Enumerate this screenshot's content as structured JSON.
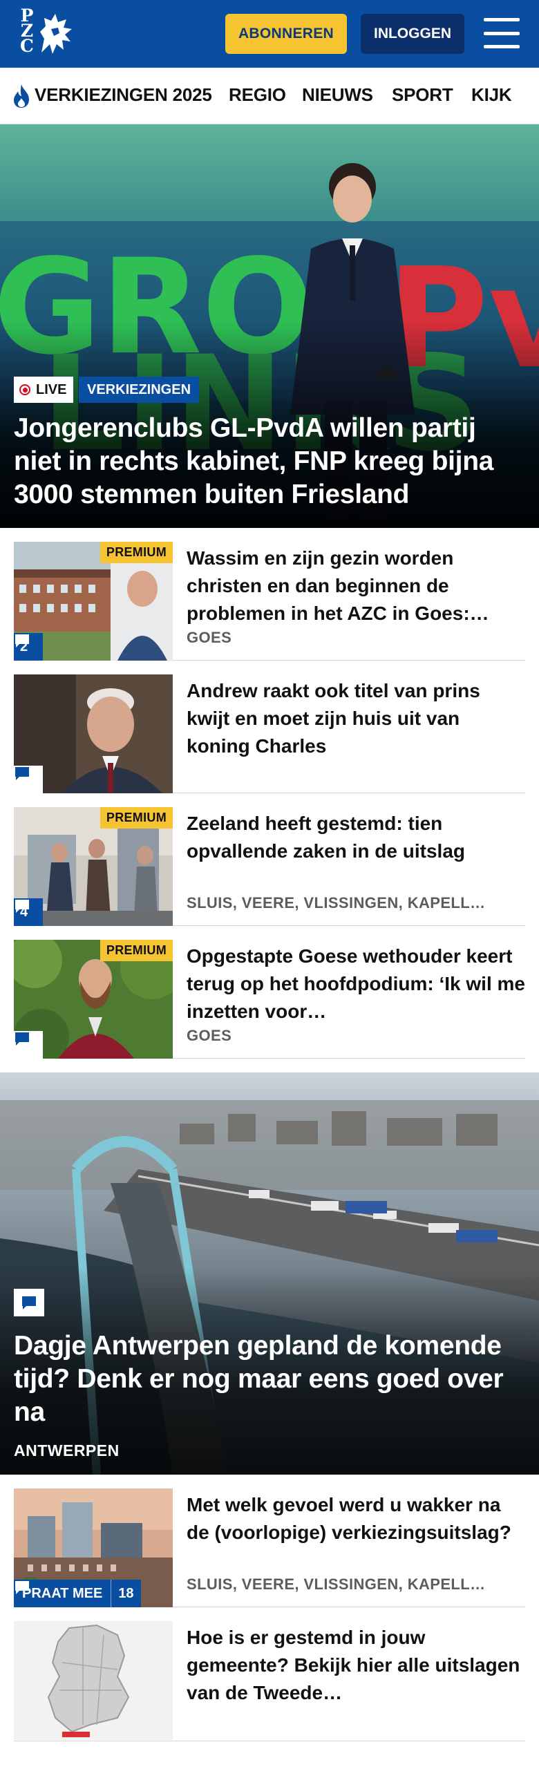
{
  "header": {
    "logo_letters": [
      "P",
      "Z",
      "C"
    ],
    "subscribe_label": "ABONNEREN",
    "login_label": "INLOGGEN",
    "icons": {
      "menu": "hamburger-menu-icon",
      "logo": "lion-logo-icon"
    }
  },
  "nav": {
    "items": [
      {
        "label": "VERKIEZINGEN 2025",
        "icon": "flame-icon"
      },
      {
        "label": "REGIO"
      },
      {
        "label": "NIEUWS"
      },
      {
        "label": "SPORT"
      },
      {
        "label": "KIJK"
      }
    ]
  },
  "hero": {
    "live_label": "LIVE",
    "section_label": "VERKIEZINGEN",
    "title": "Jongerenclubs GL-PvdA willen partij niet in rechts kabinet, FNP kreeg bijna 3000 stemmen buiten Friesland",
    "backdrop_text": "GROEN LINKS PvdA"
  },
  "articles": [
    {
      "title": "Wassim en zijn gezin worden christen en dan beginnen de problemen in het AZC in Goes:…",
      "location": "GOES",
      "premium": "PREMIUM",
      "comments": "2"
    },
    {
      "title": "Andrew raakt ook titel van prins kwijt en moet zijn huis uit van koning Charles",
      "location": "",
      "premium": "",
      "comments": ""
    },
    {
      "title": "Zeeland heeft gestemd: tien opvallende zaken in de uitslag",
      "location": "SLUIS, VEERE, VLISSINGEN, KAPELL…",
      "premium": "PREMIUM",
      "comments": "4"
    },
    {
      "title": "Opgestapte Goese wethouder keert terug op het hoofdpodium: ‘Ik wil me inzetten voor…",
      "location": "GOES",
      "premium": "PREMIUM",
      "comments": ""
    }
  ],
  "feature": {
    "title": "Dagje Antwerpen gepland de komende tijd? Denk er nog maar eens goed over na",
    "location": "ANTWERPEN"
  },
  "articles2": [
    {
      "title": "Met welk gevoel werd u wakker na de (voorlopige) verkiezingsuit­slag?",
      "location": "SLUIS, VEERE, VLISSINGEN, KAPELL…",
      "praat_label": "PRAAT MEE",
      "comments": "18"
    },
    {
      "title": "Hoe is er gestemd in jouw gemeente? Bekijk hier alle uitslagen van de Tweede…",
      "location": ""
    }
  ],
  "colors": {
    "brand_blue": "#0a4ea2",
    "subscribe_yellow": "#f6c431",
    "login_navy": "#0a2f6b",
    "live_red": "#d40a1a"
  }
}
